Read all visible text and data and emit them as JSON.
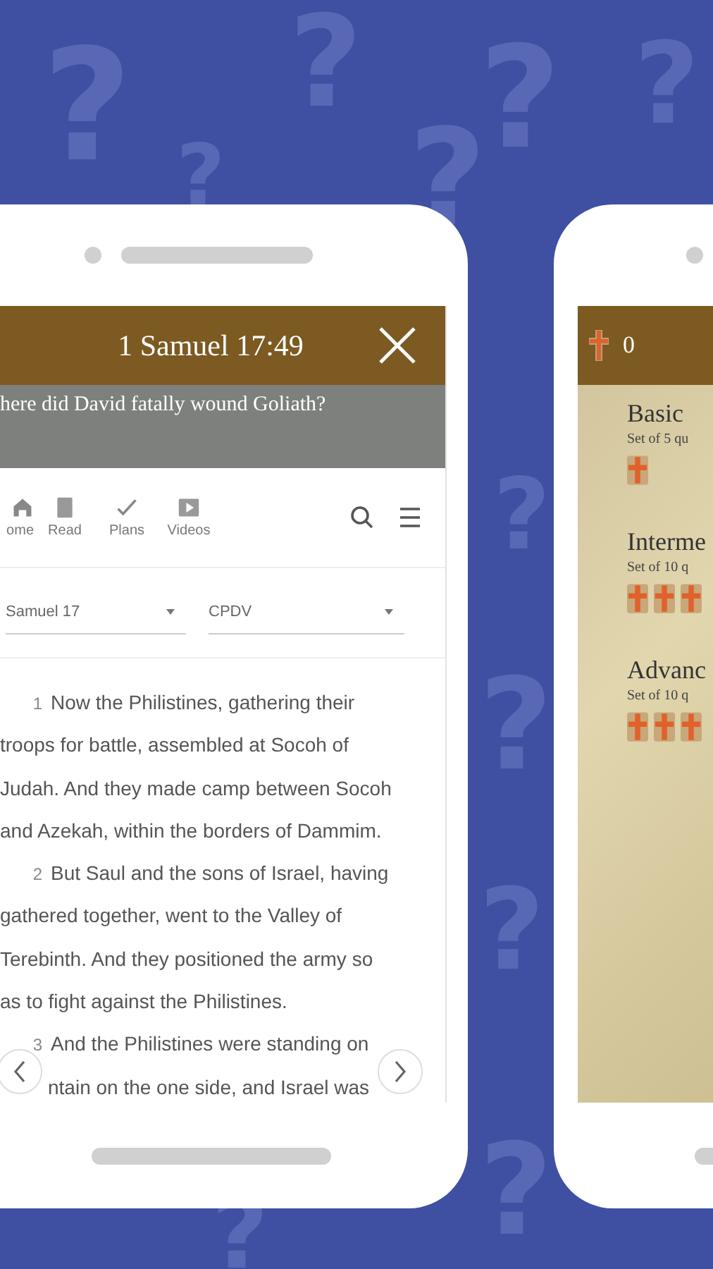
{
  "background_marks": [
    "?",
    "?",
    "?",
    "?",
    "?",
    "?",
    "?",
    "?",
    "?",
    "?",
    "?"
  ],
  "reader_phone": {
    "header": {
      "title": "1 Samuel 17:49"
    },
    "question": "here did David fatally wound Goliath?",
    "nav": [
      {
        "label": "ome"
      },
      {
        "label": "Read"
      },
      {
        "label": "Plans"
      },
      {
        "label": "Videos"
      }
    ],
    "selectors": [
      {
        "value": "Samuel 17"
      },
      {
        "value": "CPDV"
      }
    ],
    "lines": [
      {
        "text": "Now the Philistines, gathering their",
        "verse": "1"
      },
      {
        "text": "troops for battle, assembled at Socoh of"
      },
      {
        "text": "Judah. And they made camp between Socoh"
      },
      {
        "text": "and Azekah, within the borders of Dammim."
      },
      {
        "text": "But Saul and the sons of Israel, having",
        "verse": "2"
      },
      {
        "text": "gathered together, went to the Valley of"
      },
      {
        "text": "Terebinth. And they positioned the army so"
      },
      {
        "text": "as to fight against the Philistines."
      },
      {
        "text": "And the Philistines were standing on",
        "verse": "3"
      },
      {
        "text": "ntain on the one side, and Israel was"
      }
    ]
  },
  "quiz_phone": {
    "header": {
      "score": "0"
    },
    "levels": [
      {
        "title": "Basic",
        "subtitle": "Set of 5 qu",
        "crosses": [
          {
            "filled": true
          }
        ]
      },
      {
        "title": "Interme",
        "subtitle": "Set of 10 q",
        "crosses": [
          {
            "filled": true
          },
          {
            "filled": true
          },
          {
            "filled": true
          }
        ]
      },
      {
        "title": "Advanc",
        "subtitle": "Set of 10 q",
        "crosses": [
          {
            "filled": true
          },
          {
            "filled": true
          },
          {
            "filled": true
          }
        ]
      }
    ]
  }
}
